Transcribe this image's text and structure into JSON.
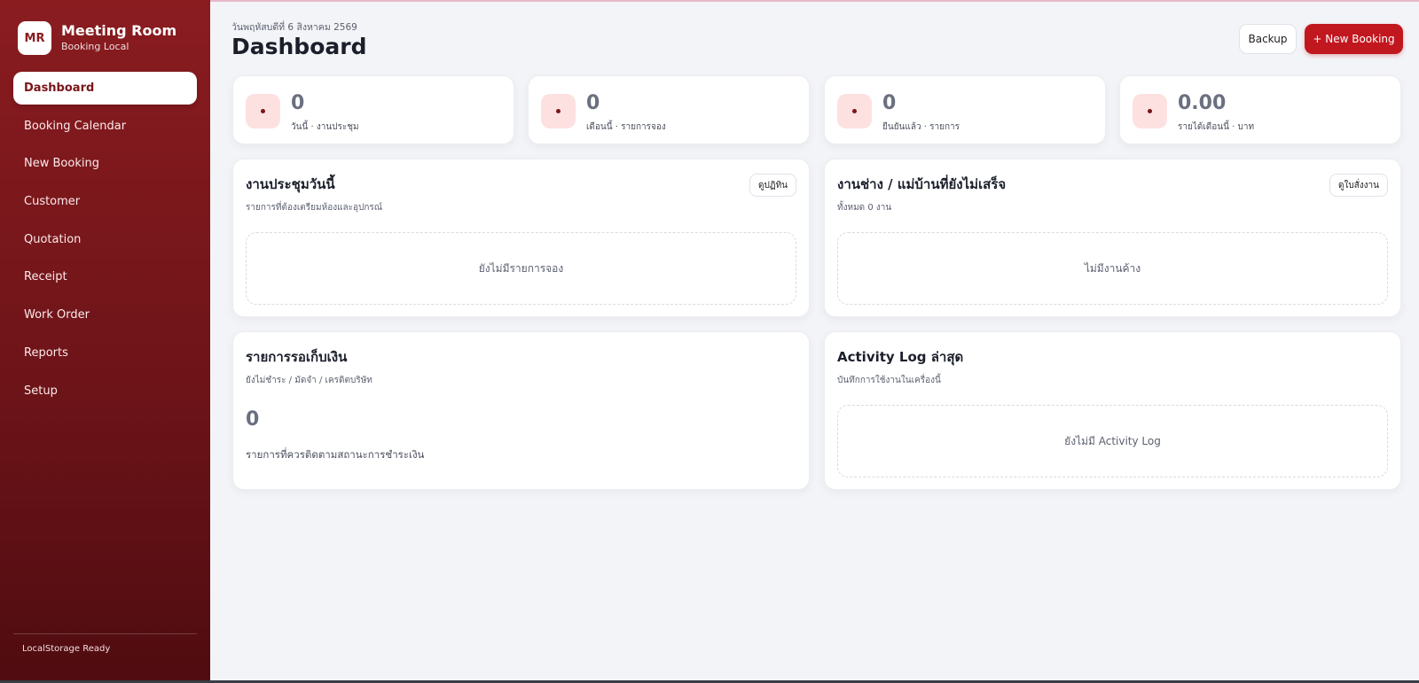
{
  "brand": {
    "logo": "MR",
    "title": "Meeting Room",
    "subtitle": "Booking Local"
  },
  "sidebar": {
    "items": [
      {
        "label": "Dashboard",
        "active": true
      },
      {
        "label": "Booking Calendar"
      },
      {
        "label": "New Booking"
      },
      {
        "label": "Customer"
      },
      {
        "label": "Quotation"
      },
      {
        "label": "Receipt"
      },
      {
        "label": "Work Order"
      },
      {
        "label": "Reports"
      },
      {
        "label": "Setup"
      }
    ],
    "footer": "LocalStorage Ready"
  },
  "header": {
    "date": "วันพฤหัสบดีที่ 6 สิงหาคม 2569",
    "title": "Dashboard",
    "backup_label": "Backup",
    "new_booking_label": "+ New Booking"
  },
  "stats": [
    {
      "value": "0",
      "label": "วันนี้ · งานประชุม"
    },
    {
      "value": "0",
      "label": "เดือนนี้ · รายการจอง"
    },
    {
      "value": "0",
      "label": "ยืนยันแล้ว · รายการ"
    },
    {
      "value": "0.00",
      "label": "รายได้เดือนนี้ · บาท"
    }
  ],
  "panels": {
    "today": {
      "title": "งานประชุมวันนี้",
      "subtitle": "รายการที่ต้องเตรียมห้องและอุปกรณ์",
      "button": "ดูปฏิทิน",
      "empty": "ยังไม่มีรายการจอง"
    },
    "pending_work": {
      "title": "งานช่าง / แม่บ้านที่ยังไม่เสร็จ",
      "subtitle": "ทั้งหมด 0 งาน",
      "button": "ดูใบสั่งงาน",
      "empty": "ไม่มีงานค้าง"
    },
    "payments": {
      "title": "รายการรอเก็บเงิน",
      "subtitle": "ยังไม่ชำระ / มัดจำ / เครดิตบริษัท",
      "count": "0",
      "caption": "รายการที่ควรติดตามสถานะการชำระเงิน"
    },
    "activity": {
      "title": "Activity Log ล่าสุด",
      "subtitle": "บันทึกการใช้งานในเครื่องนี้",
      "empty": "ยังไม่มี Activity Log"
    }
  },
  "colors": {
    "brand": "#8a1c20",
    "accent": "#c1171f",
    "icon_bg": "#fde1e1",
    "background": "#f3f4f7"
  }
}
